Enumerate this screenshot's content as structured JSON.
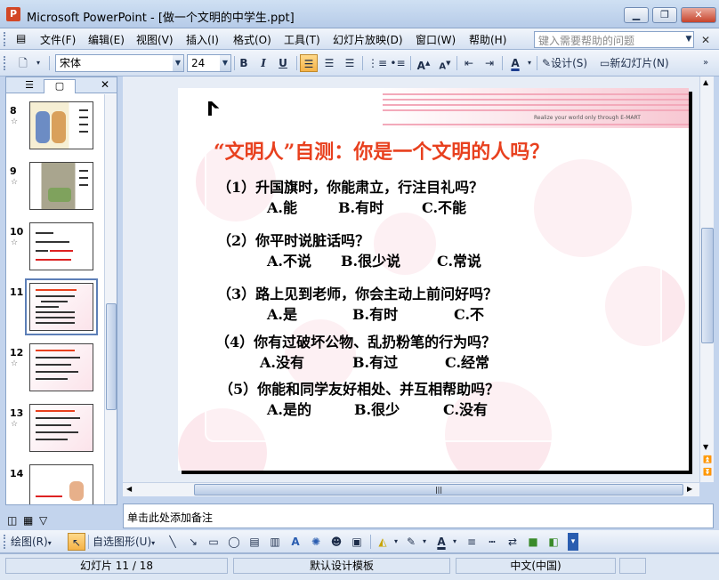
{
  "window": {
    "app_title": "Microsoft PowerPoint - [做一个文明的中学生.ppt]",
    "min_label": "▁",
    "max_label": "❐",
    "close_label": "✕"
  },
  "menu": {
    "items": [
      "文件(F)",
      "编辑(E)",
      "视图(V)",
      "插入(I)",
      "格式(O)",
      "工具(T)",
      "幻灯片放映(D)",
      "窗口(W)",
      "帮助(H)"
    ],
    "help_placeholder": "键入需要帮助的问题",
    "close_label": "✕"
  },
  "toolbar": {
    "font_name": "宋体",
    "font_size": "24",
    "bold": "B",
    "italic": "I",
    "underline": "U",
    "design_label": "设计(S)",
    "new_slide_label": "新幻灯片(N)"
  },
  "thumbnails": [
    {
      "num": "8",
      "star": "☆"
    },
    {
      "num": "9",
      "star": "☆"
    },
    {
      "num": "10",
      "star": "☆"
    },
    {
      "num": "11",
      "star": ""
    },
    {
      "num": "12",
      "star": "☆"
    },
    {
      "num": "13",
      "star": "☆"
    },
    {
      "num": "14",
      "star": ""
    }
  ],
  "slide": {
    "tagline": "Realize your world only through E-MART",
    "title": "“文明人”自测：你是一个文明的人吗？",
    "questions": [
      {
        "q": "（1）升国旗时，你能肃立，行注目礼吗？",
        "options": [
          "A.能",
          "B.有时",
          "C.不能"
        ]
      },
      {
        "q": "（2）你平时说脏话吗？",
        "options": [
          "A.不说",
          "B.很少说",
          "C.常说"
        ]
      },
      {
        "q": "（3）路上见到老师，你会主动上前问好吗？",
        "options": [
          "A.是",
          "B.有时",
          "C.不"
        ]
      },
      {
        "q": "（4）你有过破坏公物、乱扔粉笔的行为吗？",
        "options": [
          "A.没有",
          "B.有过",
          "C.经常"
        ]
      },
      {
        "q": "（5）你能和同学友好相处、并互相帮助吗？",
        "options": [
          "A.是的",
          "B.很少",
          "C.没有"
        ]
      }
    ]
  },
  "notes": {
    "placeholder": "单击此处添加备注"
  },
  "drawbar": {
    "draw_label": "绘图(R)",
    "autoshape_label": "自选图形(U)"
  },
  "status": {
    "slide_info": "幻灯片 11 / 18",
    "template": "默认设计模板",
    "language": "中文(中国)"
  }
}
